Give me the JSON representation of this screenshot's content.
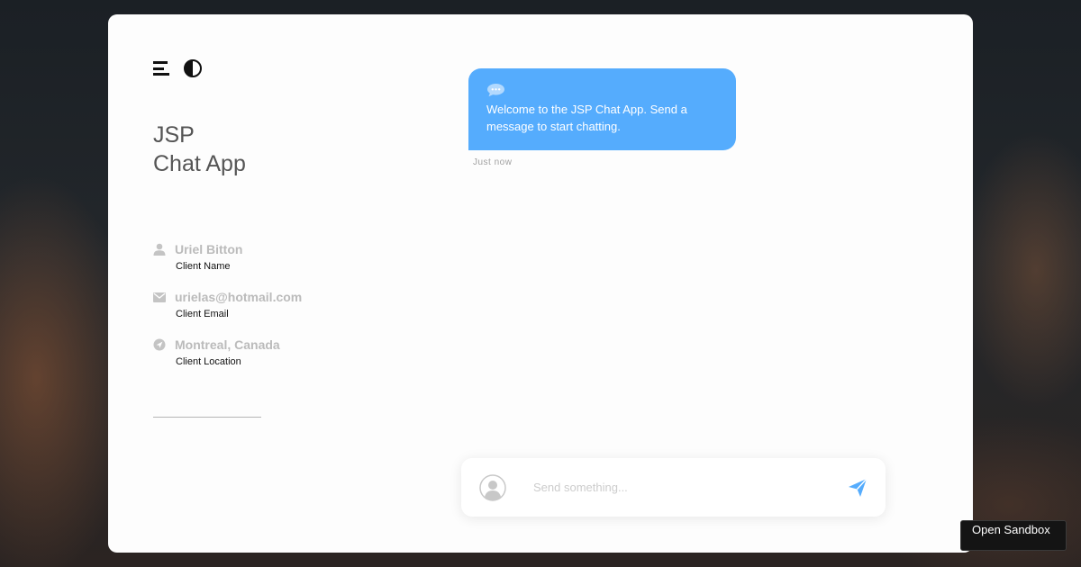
{
  "app": {
    "title_line1": "JSP",
    "title_line2": "Chat App"
  },
  "client": {
    "name": {
      "value": "Uriel Bitton",
      "label": "Client Name",
      "icon": "user-icon"
    },
    "email": {
      "value": "urielas@hotmail.com",
      "label": "Client Email",
      "icon": "mail-icon"
    },
    "location": {
      "value": "Montreal, Canada",
      "label": "Client Location",
      "icon": "location-icon"
    }
  },
  "messages": [
    {
      "text": "Welcome to the JSP Chat App. Send a message to start chatting.",
      "time": "Just now",
      "icon": "chat-bubble-icon"
    }
  ],
  "composer": {
    "placeholder": "Send something...",
    "value": "",
    "avatar_icon": "avatar-icon",
    "send_icon": "send-icon"
  },
  "sandbox": {
    "label": "Open Sandbox"
  },
  "colors": {
    "accent": "#55acfd",
    "info_text": "#bbbbbb",
    "title": "#555555"
  }
}
